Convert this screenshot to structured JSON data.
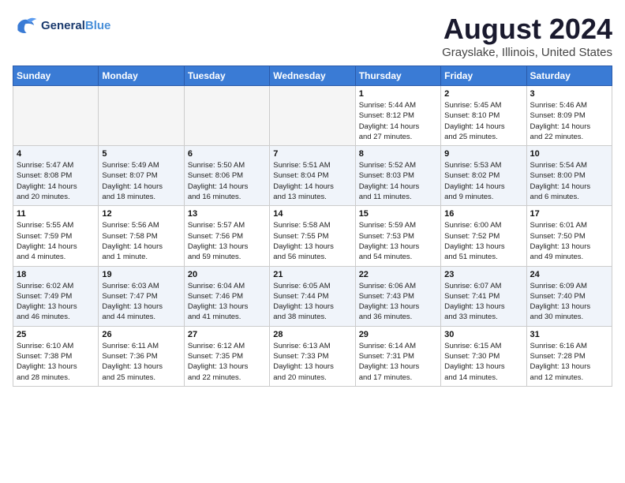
{
  "header": {
    "logo_line1": "General",
    "logo_line2": "Blue",
    "title": "August 2024",
    "subtitle": "Grayslake, Illinois, United States"
  },
  "weekdays": [
    "Sunday",
    "Monday",
    "Tuesday",
    "Wednesday",
    "Thursday",
    "Friday",
    "Saturday"
  ],
  "weeks": [
    [
      {
        "day": "",
        "info": ""
      },
      {
        "day": "",
        "info": ""
      },
      {
        "day": "",
        "info": ""
      },
      {
        "day": "",
        "info": ""
      },
      {
        "day": "1",
        "info": "Sunrise: 5:44 AM\nSunset: 8:12 PM\nDaylight: 14 hours\nand 27 minutes."
      },
      {
        "day": "2",
        "info": "Sunrise: 5:45 AM\nSunset: 8:10 PM\nDaylight: 14 hours\nand 25 minutes."
      },
      {
        "day": "3",
        "info": "Sunrise: 5:46 AM\nSunset: 8:09 PM\nDaylight: 14 hours\nand 22 minutes."
      }
    ],
    [
      {
        "day": "4",
        "info": "Sunrise: 5:47 AM\nSunset: 8:08 PM\nDaylight: 14 hours\nand 20 minutes."
      },
      {
        "day": "5",
        "info": "Sunrise: 5:49 AM\nSunset: 8:07 PM\nDaylight: 14 hours\nand 18 minutes."
      },
      {
        "day": "6",
        "info": "Sunrise: 5:50 AM\nSunset: 8:06 PM\nDaylight: 14 hours\nand 16 minutes."
      },
      {
        "day": "7",
        "info": "Sunrise: 5:51 AM\nSunset: 8:04 PM\nDaylight: 14 hours\nand 13 minutes."
      },
      {
        "day": "8",
        "info": "Sunrise: 5:52 AM\nSunset: 8:03 PM\nDaylight: 14 hours\nand 11 minutes."
      },
      {
        "day": "9",
        "info": "Sunrise: 5:53 AM\nSunset: 8:02 PM\nDaylight: 14 hours\nand 9 minutes."
      },
      {
        "day": "10",
        "info": "Sunrise: 5:54 AM\nSunset: 8:00 PM\nDaylight: 14 hours\nand 6 minutes."
      }
    ],
    [
      {
        "day": "11",
        "info": "Sunrise: 5:55 AM\nSunset: 7:59 PM\nDaylight: 14 hours\nand 4 minutes."
      },
      {
        "day": "12",
        "info": "Sunrise: 5:56 AM\nSunset: 7:58 PM\nDaylight: 14 hours\nand 1 minute."
      },
      {
        "day": "13",
        "info": "Sunrise: 5:57 AM\nSunset: 7:56 PM\nDaylight: 13 hours\nand 59 minutes."
      },
      {
        "day": "14",
        "info": "Sunrise: 5:58 AM\nSunset: 7:55 PM\nDaylight: 13 hours\nand 56 minutes."
      },
      {
        "day": "15",
        "info": "Sunrise: 5:59 AM\nSunset: 7:53 PM\nDaylight: 13 hours\nand 54 minutes."
      },
      {
        "day": "16",
        "info": "Sunrise: 6:00 AM\nSunset: 7:52 PM\nDaylight: 13 hours\nand 51 minutes."
      },
      {
        "day": "17",
        "info": "Sunrise: 6:01 AM\nSunset: 7:50 PM\nDaylight: 13 hours\nand 49 minutes."
      }
    ],
    [
      {
        "day": "18",
        "info": "Sunrise: 6:02 AM\nSunset: 7:49 PM\nDaylight: 13 hours\nand 46 minutes."
      },
      {
        "day": "19",
        "info": "Sunrise: 6:03 AM\nSunset: 7:47 PM\nDaylight: 13 hours\nand 44 minutes."
      },
      {
        "day": "20",
        "info": "Sunrise: 6:04 AM\nSunset: 7:46 PM\nDaylight: 13 hours\nand 41 minutes."
      },
      {
        "day": "21",
        "info": "Sunrise: 6:05 AM\nSunset: 7:44 PM\nDaylight: 13 hours\nand 38 minutes."
      },
      {
        "day": "22",
        "info": "Sunrise: 6:06 AM\nSunset: 7:43 PM\nDaylight: 13 hours\nand 36 minutes."
      },
      {
        "day": "23",
        "info": "Sunrise: 6:07 AM\nSunset: 7:41 PM\nDaylight: 13 hours\nand 33 minutes."
      },
      {
        "day": "24",
        "info": "Sunrise: 6:09 AM\nSunset: 7:40 PM\nDaylight: 13 hours\nand 30 minutes."
      }
    ],
    [
      {
        "day": "25",
        "info": "Sunrise: 6:10 AM\nSunset: 7:38 PM\nDaylight: 13 hours\nand 28 minutes."
      },
      {
        "day": "26",
        "info": "Sunrise: 6:11 AM\nSunset: 7:36 PM\nDaylight: 13 hours\nand 25 minutes."
      },
      {
        "day": "27",
        "info": "Sunrise: 6:12 AM\nSunset: 7:35 PM\nDaylight: 13 hours\nand 22 minutes."
      },
      {
        "day": "28",
        "info": "Sunrise: 6:13 AM\nSunset: 7:33 PM\nDaylight: 13 hours\nand 20 minutes."
      },
      {
        "day": "29",
        "info": "Sunrise: 6:14 AM\nSunset: 7:31 PM\nDaylight: 13 hours\nand 17 minutes."
      },
      {
        "day": "30",
        "info": "Sunrise: 6:15 AM\nSunset: 7:30 PM\nDaylight: 13 hours\nand 14 minutes."
      },
      {
        "day": "31",
        "info": "Sunrise: 6:16 AM\nSunset: 7:28 PM\nDaylight: 13 hours\nand 12 minutes."
      }
    ]
  ]
}
